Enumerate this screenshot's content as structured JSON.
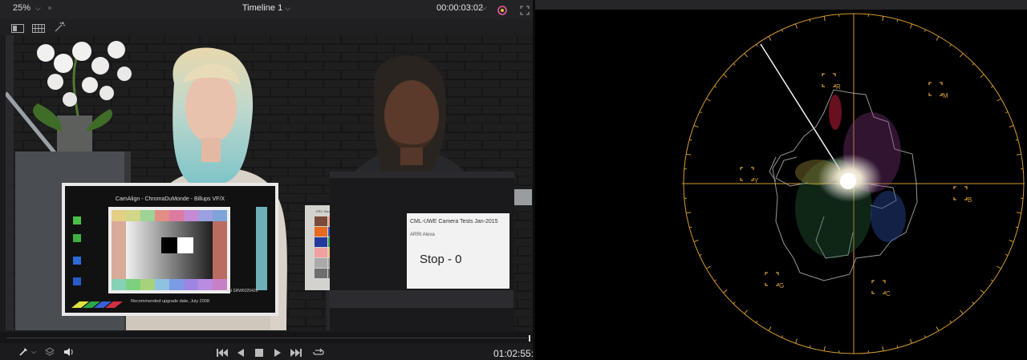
{
  "viewer": {
    "zoom": "25%",
    "timeline_title": "Timeline 1",
    "timecode": "00:00:03:02",
    "current_time": "01:02:55:"
  },
  "video_frame": {
    "chart_left": {
      "title": "CamAlign - ChromaDuMonde - Billups VF/X",
      "footer": "Recommended upgrade date, July 2008",
      "serial": "SN SRW6025426"
    },
    "chart_middle": {
      "title": "CRC Source 11 - High Resolution Color Reference Chart"
    },
    "slate": {
      "title": "CML-UWE Camera Tests Jan-2015",
      "camera": "ARRI Alexa",
      "stop": "Stop - 0"
    }
  },
  "vectorscope": {
    "targets": [
      "R",
      "M",
      "B",
      "C",
      "G",
      "Y"
    ],
    "graticule_color": "#d39a2f"
  }
}
